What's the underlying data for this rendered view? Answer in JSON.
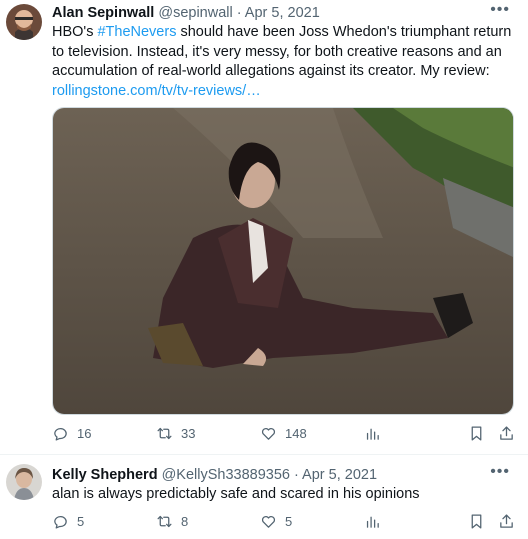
{
  "tweets": [
    {
      "author_name": "Alan Sepinwall",
      "handle_and_date": "@sepinwall · Apr 5, 2021",
      "more_icon": "more-icon",
      "text_before": "HBO's ",
      "hashtag": "#TheNevers",
      "text_after": " should have been Joss Whedon's triumphant return to television. Instead, it's very messy, for both creative reasons and an accumulation of real-world allegations against its creator. My review: ",
      "link": "rollingstone.com/tv/tv-reviews/…",
      "replies": "16",
      "retweets": "33",
      "likes": "148"
    },
    {
      "author_name": "Kelly Shepherd",
      "handle_and_date": "@KellySh33889356 · Apr 5, 2021",
      "text": "alan is always predictably safe and scared in his opinions",
      "replies": "5",
      "retweets": "8",
      "likes": "5"
    }
  ],
  "colors": {
    "accent": "#1d9bf0",
    "secondary_text": "#536471",
    "divider": "#eff3f4"
  }
}
